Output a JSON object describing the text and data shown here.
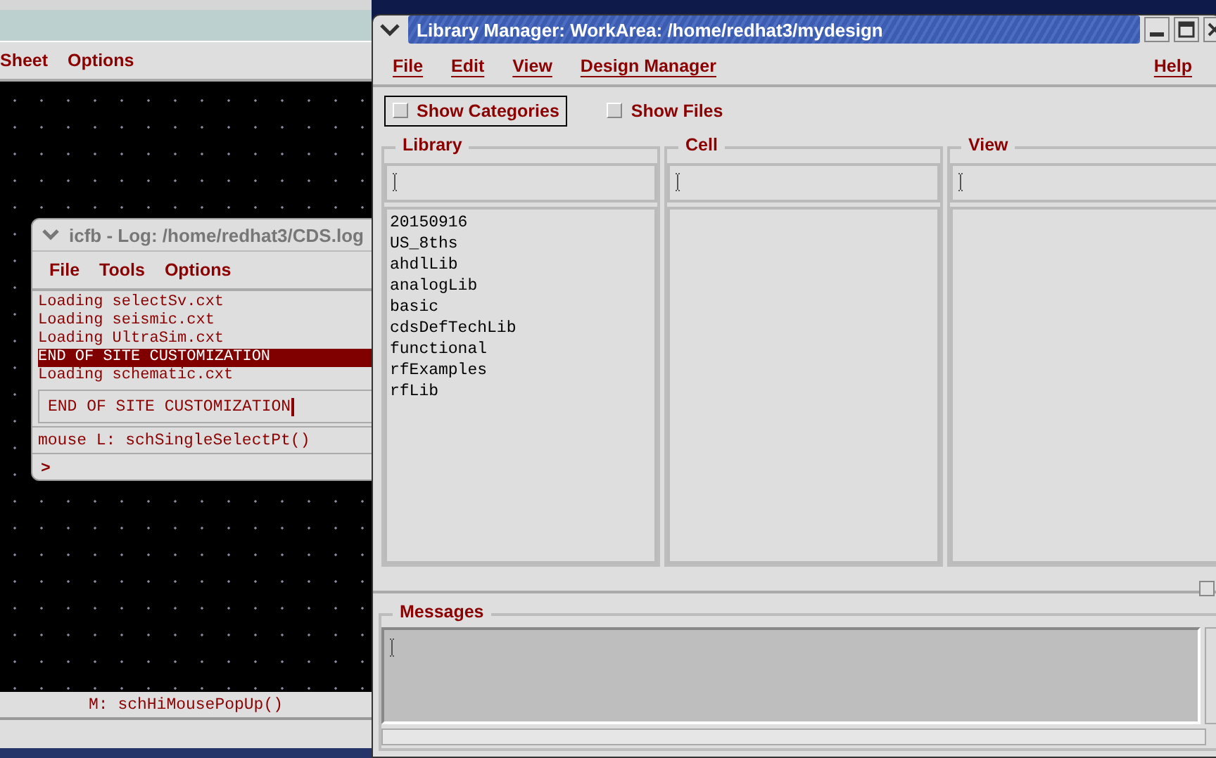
{
  "schematic": {
    "menu": [
      "Sheet",
      "Options"
    ],
    "status": "M: schHiMousePopUp()"
  },
  "log_window": {
    "title": "icfb - Log: /home/redhat3/CDS.log",
    "menu": [
      "File",
      "Tools",
      "Options"
    ],
    "lines": [
      {
        "text": "Loading selectSv.cxt",
        "selected": false
      },
      {
        "text": "Loading seismic.cxt",
        "selected": false
      },
      {
        "text": "Loading UltraSim.cxt",
        "selected": false
      },
      {
        "text": "END OF SITE CUSTOMIZATION",
        "selected": true
      },
      {
        "text": "Loading schematic.cxt",
        "selected": false
      }
    ],
    "input": "END OF SITE CUSTOMIZATION",
    "mouse": "mouse L: schSingleSelectPt()",
    "prompt": ">"
  },
  "library_manager": {
    "title": "Library Manager: WorkArea: /home/redhat3/mydesign",
    "menu": [
      "File",
      "Edit",
      "View",
      "Design Manager"
    ],
    "help": "Help",
    "checkboxes": [
      {
        "label": "Show Categories",
        "checked": false,
        "focused": true
      },
      {
        "label": "Show Files",
        "checked": false,
        "focused": false
      }
    ],
    "columns": [
      {
        "title": "Library",
        "items": [
          "20150916",
          "US_8ths",
          "ahdlLib",
          "analogLib",
          "basic",
          "cdsDefTechLib",
          "functional",
          "rfExamples",
          "rfLib"
        ]
      },
      {
        "title": "Cell"
      },
      {
        "title": "View"
      }
    ],
    "messages": {
      "title": "Messages"
    }
  }
}
